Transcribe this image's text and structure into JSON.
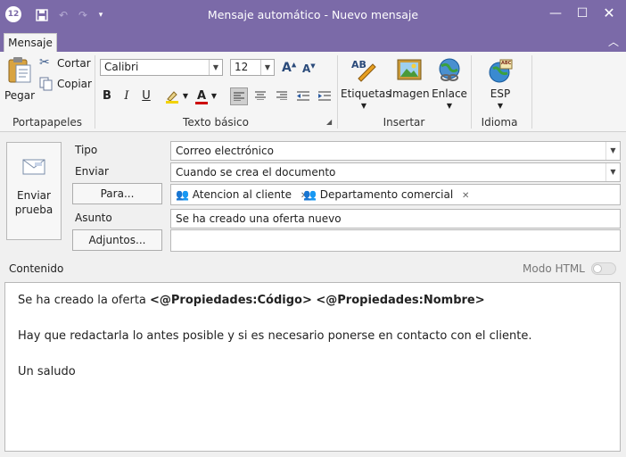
{
  "window": {
    "title": "Mensaje automático - Nuevo mensaje",
    "app_badge": "12"
  },
  "colors": {
    "titlebar": "#7b6aa8",
    "ribbon_bg": "#f5f5f5",
    "accent": "#7b6aa8"
  },
  "tabs": [
    {
      "label": "Mensaje"
    }
  ],
  "ribbon": {
    "portapapeles": {
      "label": "Portapapeles",
      "pegar": "Pegar",
      "cortar": "Cortar",
      "copiar": "Copiar"
    },
    "texto_basico": {
      "label": "Texto básico",
      "font_family": "Calibri",
      "font_size": "12",
      "bold": "B",
      "italic": "I",
      "underline": "U"
    },
    "insertar": {
      "label": "Insertar",
      "etiquetas": "Etiquetas",
      "imagen": "Imagen",
      "enlace": "Enlace"
    },
    "idioma": {
      "label": "Idioma",
      "language": "ESP",
      "icon_text": "ABC"
    }
  },
  "form": {
    "send_test": {
      "line1": "Enviar",
      "line2": "prueba"
    },
    "tipo": {
      "label": "Tipo",
      "value": "Correo electrónico"
    },
    "enviar": {
      "label": "Enviar",
      "value": "Cuando se crea el documento"
    },
    "para": {
      "button": "Para...",
      "recipients": [
        "Atencion al cliente",
        "Departamento comercial"
      ]
    },
    "asunto": {
      "label": "Asunto",
      "value": "Se ha creado una oferta nuevo"
    },
    "adjuntos": {
      "button": "Adjuntos...",
      "value": ""
    },
    "contenido_label": "Contenido",
    "html_mode": {
      "label": "Modo HTML",
      "on": false
    }
  },
  "content": {
    "line1_prefix": "Se ha creado la oferta ",
    "line1_bold": "<@Propiedades:Código> <@Propiedades:Nombre>",
    "line2": "Hay que redactarla lo antes posible y si es necesario ponerse en contacto con el cliente.",
    "line3": "Un saludo"
  }
}
